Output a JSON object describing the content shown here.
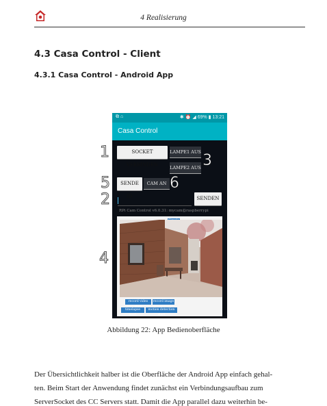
{
  "header": {
    "running_head": "4 Realisierung"
  },
  "section": {
    "title": "4.3 Casa Control - Client",
    "subsection_title": "4.3.1 Casa Control - Android App"
  },
  "figure": {
    "status_left": "⧉ ⌂",
    "status_right": "✱ ⏰ ◢ 69% ▮ 13:21",
    "app_title": "Casa Control",
    "buttons": {
      "socket_connect": "SOCKET VERBINDEN",
      "lamp1_off": "LAMPE1 AUS",
      "lamp2_off": "LAMPE2 AUS",
      "send_id": "SENDE ID",
      "cam_on": "CAM AN",
      "send": "SENDEN"
    },
    "markers": {
      "m1": "1",
      "m2": "2",
      "m3": "3",
      "m4": "4",
      "m5": "5",
      "m6": "6"
    },
    "connection_text": "RPi Cam Control v6.0.31: mycam@raspberrypi",
    "webview": {
      "simple_label": "Simple",
      "buttons": [
        "record video start",
        "record image",
        "timelapse start",
        "motion detection start"
      ]
    },
    "caption": "Abbildung 22: App Bedienoberfläche"
  },
  "body_text": {
    "line1": "Der Übersichtlichkeit halber ist die Oberfläche der Android App einfach gehal-",
    "line2": "ten. Beim Start der Anwendung findet zunächst ein Verbindungsaufbau zum",
    "line3": "ServerSocket des CC Servers statt. Damit die App parallel dazu weiterhin be-"
  }
}
